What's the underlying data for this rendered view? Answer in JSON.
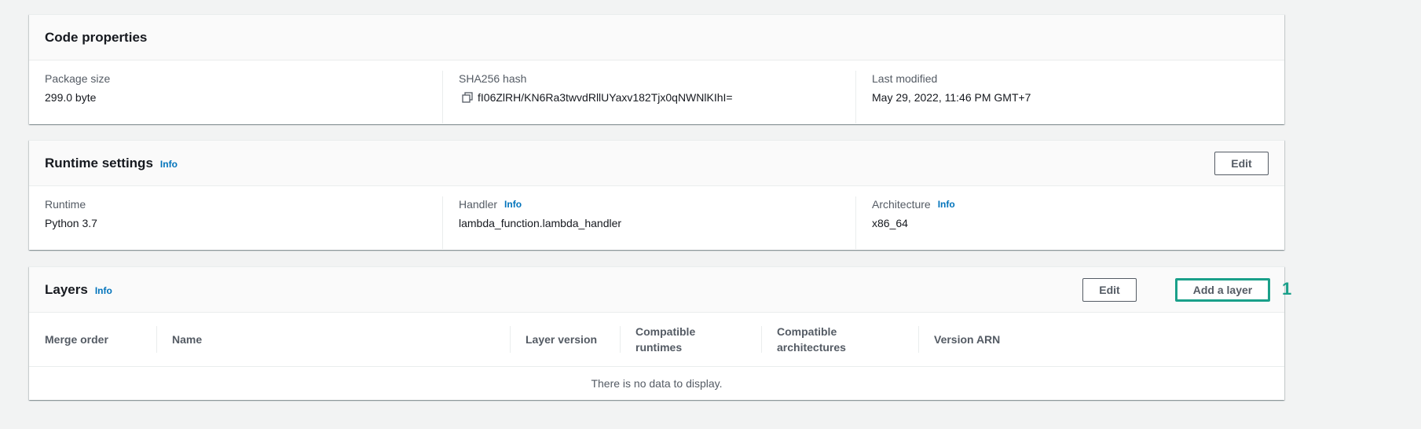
{
  "code_properties": {
    "title": "Code properties",
    "package_size_label": "Package size",
    "package_size_value": "299.0 byte",
    "sha_label": "SHA256 hash",
    "sha_value": "fI06ZlRH/KN6Ra3twvdRllUYaxv182Tjx0qNWNlKIhI=",
    "last_modified_label": "Last modified",
    "last_modified_value": "May 29, 2022, 11:46 PM GMT+7"
  },
  "runtime_settings": {
    "title": "Runtime settings",
    "info_label": "Info",
    "edit_label": "Edit",
    "runtime_label": "Runtime",
    "runtime_value": "Python 3.7",
    "handler_label": "Handler",
    "handler_value": "lambda_function.lambda_handler",
    "architecture_label": "Architecture",
    "architecture_value": "x86_64"
  },
  "layers": {
    "title": "Layers",
    "info_label": "Info",
    "edit_label": "Edit",
    "add_label": "Add a layer",
    "columns": [
      "Merge order",
      "Name",
      "Layer version",
      "Compatible runtimes",
      "Compatible architectures",
      "Version ARN"
    ],
    "empty_text": "There is no data to display."
  },
  "annotation": {
    "step_number": "1",
    "color": "#1aa08a"
  },
  "colors": {
    "link": "#0073bb",
    "background": "#f2f3f3"
  },
  "icons": {
    "copy": "copy-icon"
  }
}
